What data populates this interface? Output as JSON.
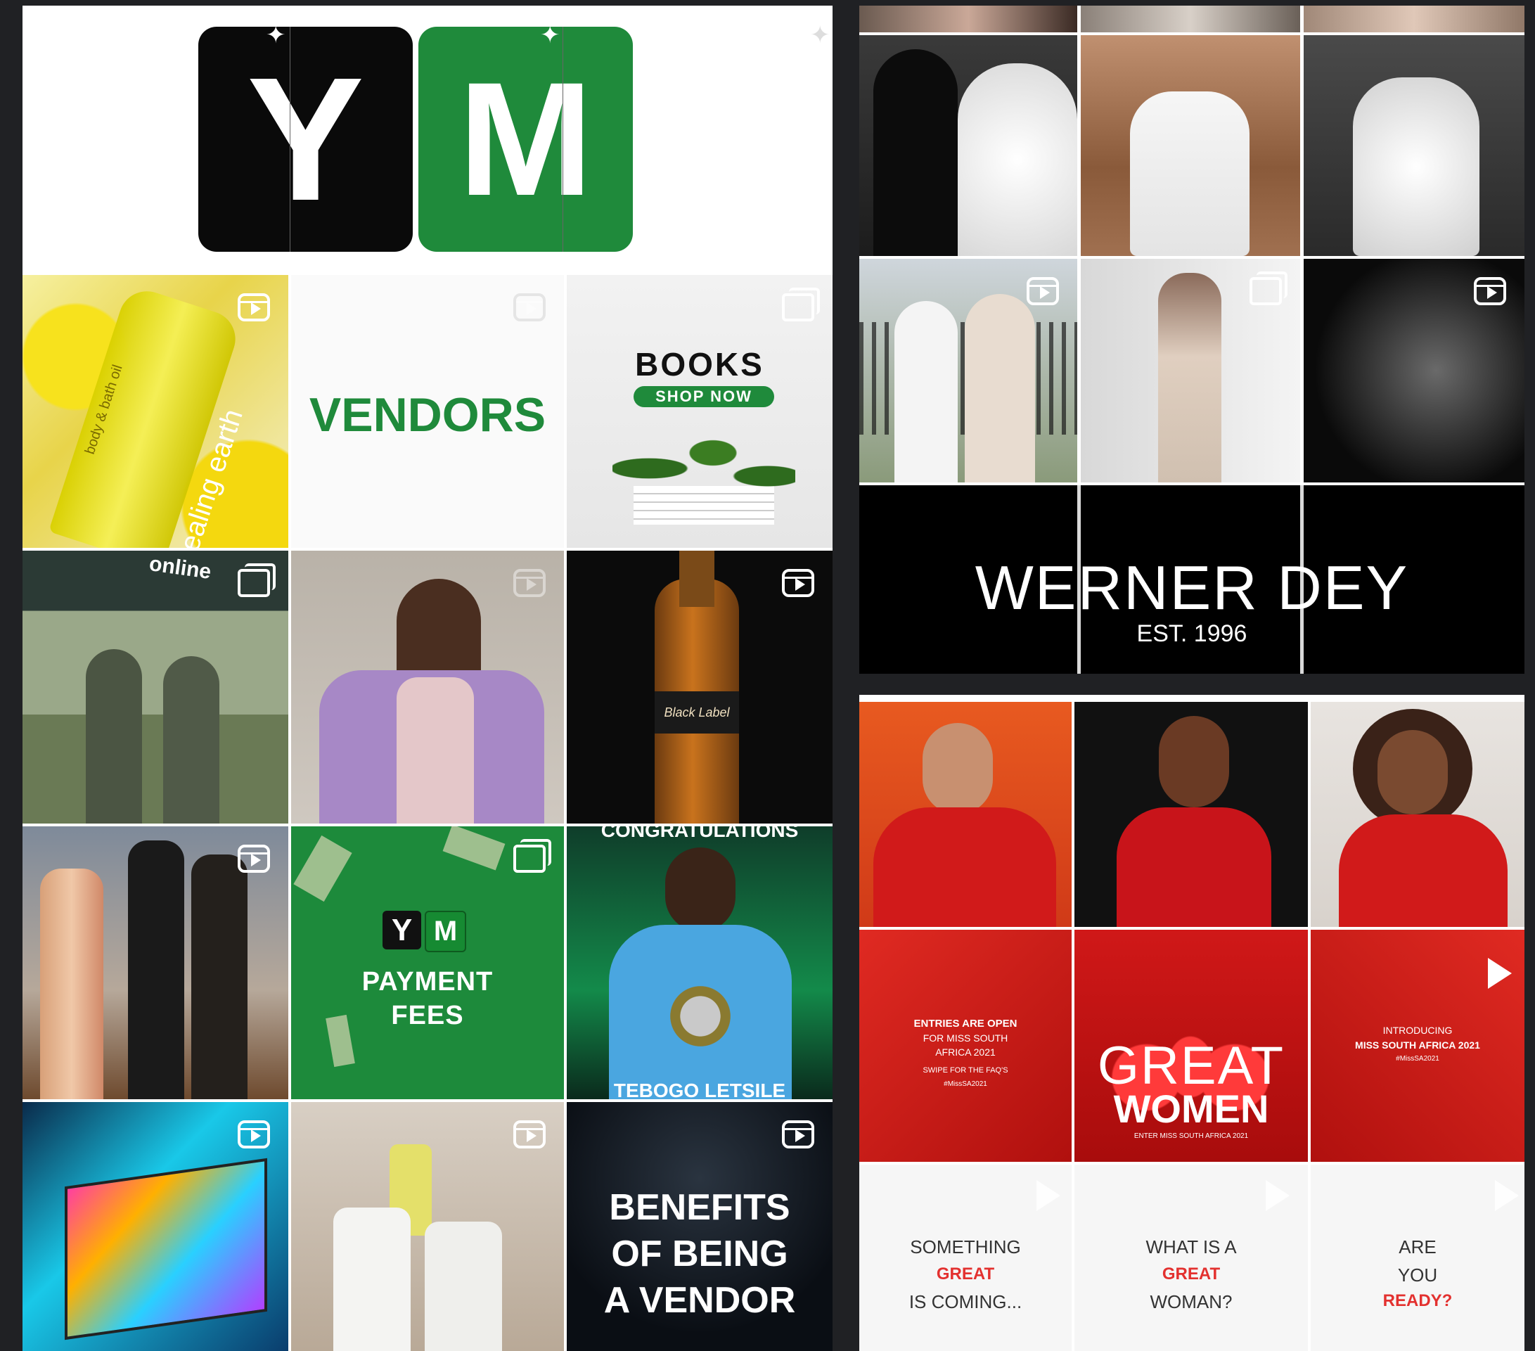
{
  "logo_tile": {
    "letter_y": "Y",
    "letter_m": "M"
  },
  "ym_grid": {
    "tiles": {
      "healing_earth": {
        "brand": "healing earth",
        "product": "body & bath oil",
        "badge": "reel-icon"
      },
      "vendors": {
        "text": "VENDORS",
        "badge": "reel-icon"
      },
      "books": {
        "title": "BOOKS",
        "button": "SHOP NOW",
        "badge": "multi-photo-icon"
      },
      "market_stall": {
        "banner": "online",
        "badge": "multi-photo-icon"
      },
      "skateboard_woman": {
        "badge": "reel-icon"
      },
      "beer_bottle": {
        "label": "Black Label",
        "badge": "reel-icon"
      },
      "wine_bottles": {
        "badge": "reel-icon"
      },
      "payment_fees": {
        "logo_y": "Y",
        "logo_m": "M",
        "line1": "PAYMENT",
        "line2": "FEES",
        "badge": "multi-photo-icon"
      },
      "athlete": {
        "top_text": "CONGRATULATIONS",
        "bottom_text": "TEBOGO LETSILE"
      },
      "television": {
        "badge": "reel-icon"
      },
      "lotion_bottles": {
        "badge": "reel-icon"
      },
      "benefits": {
        "line1": "BENEFITS",
        "line2": "OF BEING",
        "line3": "A VENDOR",
        "badge": "reel-icon"
      }
    }
  },
  "werner_grid": {
    "brand_name": "WERNER DEY",
    "established": "EST. 1996",
    "badges": [
      "reel-icon",
      "multi-photo-icon",
      "reel-icon"
    ]
  },
  "miss_sa_grid": {
    "entries_tile": {
      "line1": "ENTRIES ARE OPEN",
      "line2": "FOR MISS SOUTH",
      "line3": "AFRICA 2021",
      "line4": "SWIPE FOR THE FAQ'S",
      "line5": "#MissSA2021"
    },
    "great_women_tile": {
      "line1": "GREAT",
      "line2": "WOMEN",
      "caption": "ENTER MISS SOUTH AFRICA 2021"
    },
    "introducing_tile": {
      "line1": "INTRODUCING",
      "line2": "MISS SOUTH AFRICA 2021",
      "line3": "#MissSA2021"
    },
    "teaser_1": {
      "line1": "SOMETHING",
      "line2": "GREAT",
      "line3": "IS COMING..."
    },
    "teaser_2": {
      "line1": "WHAT IS A",
      "line2": "GREAT",
      "line3": "WOMAN?"
    },
    "teaser_3": {
      "line1": "ARE",
      "line2": "YOU",
      "line3": "READY?"
    }
  },
  "colors": {
    "background": "#202124",
    "ym_green": "#1f8a3b",
    "missa_red": "#d71920",
    "great_red": "#e3312f"
  }
}
